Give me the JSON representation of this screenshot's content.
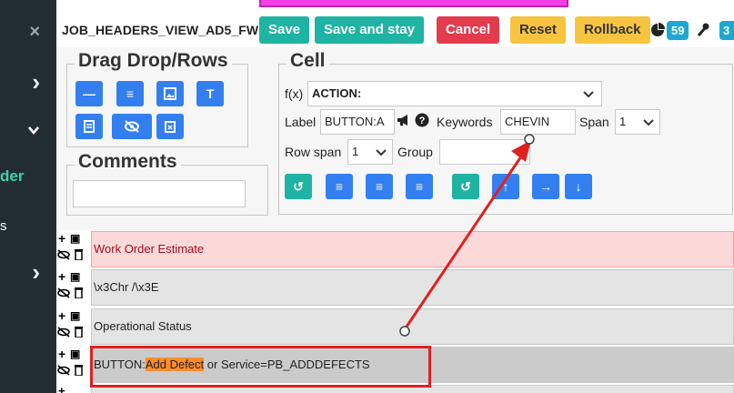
{
  "sidebar": {
    "items": [
      {
        "icon": "close-icon",
        "glyph": "×"
      },
      {
        "icon": "chevron-right-icon",
        "glyph": "›"
      },
      {
        "icon": "chevron-down-icon",
        "glyph": "⌄"
      },
      {
        "text": "der"
      },
      {
        "text": "s"
      },
      {
        "icon": "chevron-right-icon",
        "glyph": "›"
      }
    ]
  },
  "header": {
    "title": "JOB_HEADERS_VIEW_AD5_FW",
    "buttons": {
      "save": "Save",
      "save_stay": "Save and stay",
      "cancel": "Cancel",
      "reset": "Reset",
      "rollback": "Rollback"
    },
    "badge1": "59",
    "badge2": "3"
  },
  "dragdrop": {
    "legend": "Drag Drop/Rows"
  },
  "comments": {
    "legend": "Comments",
    "value": ""
  },
  "cell": {
    "legend": "Cell",
    "fx_label": "f(x)",
    "fx_value": "ACTION:",
    "label_label": "Label",
    "label_value": "BUTTON:A",
    "keywords_label": "Keywords",
    "keywords_value": "CHEVIN",
    "span_label": "Span",
    "span_value": "1",
    "rowspan_label": "Row span",
    "rowspan_value": "1",
    "group_label": "Group",
    "group_value": ""
  },
  "rows": [
    {
      "text": "Work Order Estimate"
    },
    {
      "text": "\\x3Chr /\\x3E"
    },
    {
      "text": "Operational Status"
    },
    {
      "prefix": "BUTTON:",
      "highlight": "Add Defect",
      "suffix": " or Service=PB_ADDDEFECTS"
    }
  ],
  "colors": {
    "accent_teal": "#1fb3a3",
    "cancel_red": "#e33c4d",
    "reset_yellow": "#f7c440",
    "blue": "#337ff0",
    "annotation_red": "#e02020",
    "highlight_orange": "#fd8c2d"
  }
}
